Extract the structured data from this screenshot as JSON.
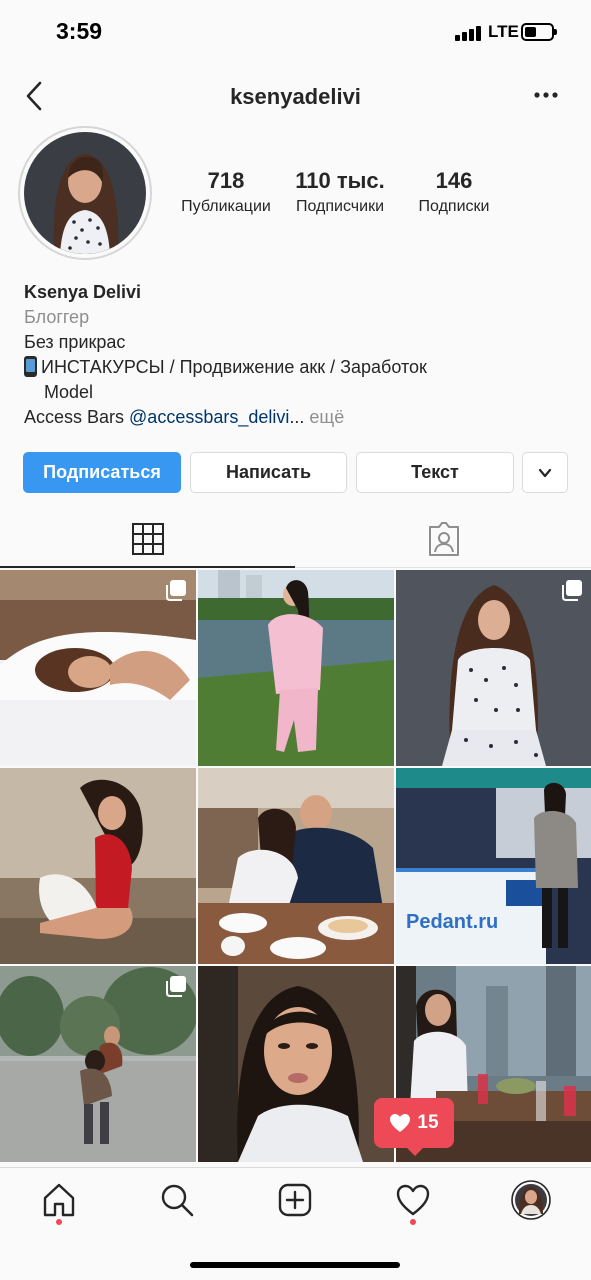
{
  "status_bar": {
    "time": "3:59",
    "network": "LTE",
    "signal_icon": "cellular-signal-icon",
    "battery_icon": "battery-icon"
  },
  "header": {
    "username": "ksenyadelivi",
    "back_icon": "chevron-left-icon",
    "more_icon": "more-horizontal-icon"
  },
  "profile": {
    "stats": [
      {
        "value": "718",
        "label": "Публикации"
      },
      {
        "value": "110 тыс.",
        "label": "Подписчики"
      },
      {
        "value": "146",
        "label": "Подписки"
      }
    ],
    "name": "Ksenya Delivi",
    "category": "Блоггер",
    "bio_line1": "Без прикрас",
    "bio_line2": "ИНСТАКУРСЫ / Продвижение акк / Заработок",
    "bio_line3": "Model",
    "bio_line4_prefix": "Access Bars ",
    "bio_mention": "@accessbars_delivi",
    "bio_ellipsis": "...",
    "bio_more": " ещё"
  },
  "actions": {
    "follow": "Подписаться",
    "message": "Написать",
    "text": "Текст"
  },
  "colors": {
    "accent": "#3897f0",
    "notification": "#ed4956",
    "link": "#003569"
  },
  "notification": {
    "count": "15",
    "icon": "heart-icon"
  },
  "grid": {
    "posts": [
      {
        "id": 1,
        "multi": true
      },
      {
        "id": 2,
        "multi": false
      },
      {
        "id": 3,
        "multi": true
      },
      {
        "id": 4,
        "multi": false
      },
      {
        "id": 5,
        "multi": false
      },
      {
        "id": 6,
        "multi": false
      },
      {
        "id": 7,
        "multi": true
      },
      {
        "id": 8,
        "multi": false
      },
      {
        "id": 9,
        "multi": false
      }
    ],
    "sign_text": "Pedant.ru"
  }
}
